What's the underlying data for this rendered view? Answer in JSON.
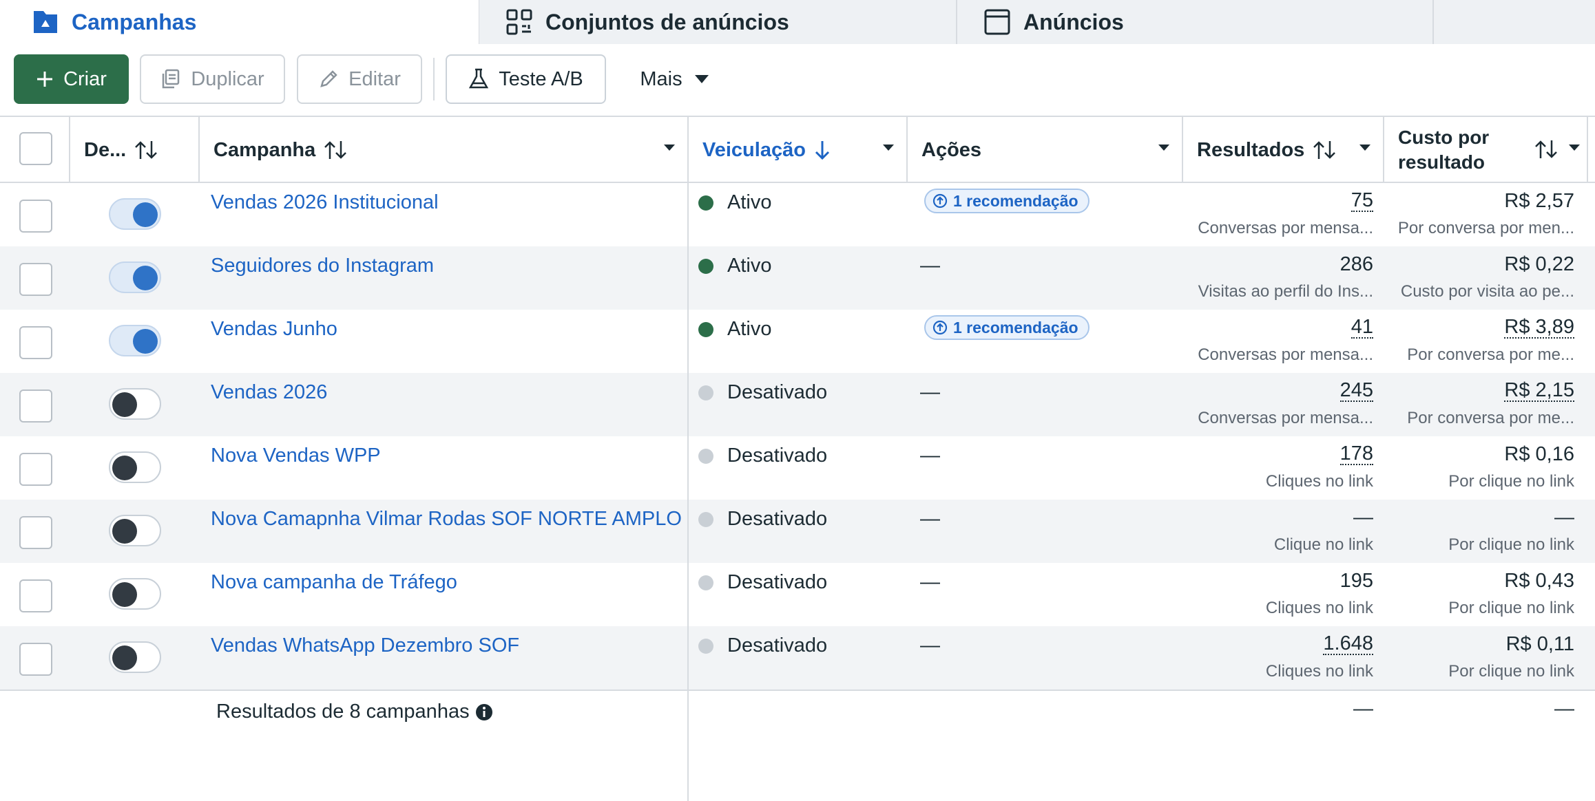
{
  "tabs": [
    {
      "label": "Campanhas",
      "icon": "folder-icon",
      "active": true
    },
    {
      "label": "Conjuntos de anúncios",
      "icon": "grid-icon",
      "active": false
    },
    {
      "label": "Anúncios",
      "icon": "ad-window-icon",
      "active": false
    }
  ],
  "toolbar": {
    "create_label": "Criar",
    "duplicate_label": "Duplicar",
    "edit_label": "Editar",
    "abtest_label": "Teste A/B",
    "more_label": "Mais"
  },
  "columns": {
    "delivery_toggle": "De...",
    "campaign": "Campanha",
    "delivery": "Veiculação",
    "actions": "Ações",
    "results": "Resultados",
    "cost_line1": "Custo por",
    "cost_line2": "resultado"
  },
  "rows": [
    {
      "name": "Vendas 2026 Institucional",
      "on": true,
      "status": "Ativo",
      "active": true,
      "action": "1 recomendação",
      "result": "75",
      "result_dotted": true,
      "result_label": "Conversas por mensa...",
      "cost": "R$ 2,57",
      "cost_dotted": false,
      "cost_label": "Por conversa por men..."
    },
    {
      "name": "Seguidores do Instagram",
      "on": true,
      "status": "Ativo",
      "active": true,
      "action": "—",
      "result": "286",
      "result_dotted": false,
      "result_label": "Visitas ao perfil do Ins...",
      "cost": "R$ 0,22",
      "cost_dotted": false,
      "cost_label": "Custo por visita ao pe..."
    },
    {
      "name": "Vendas Junho",
      "on": true,
      "status": "Ativo",
      "active": true,
      "action": "1 recomendação",
      "result": "41",
      "result_dotted": true,
      "result_label": "Conversas por mensa...",
      "cost": "R$ 3,89",
      "cost_dotted": true,
      "cost_label": "Por conversa por me..."
    },
    {
      "name": "Vendas 2026",
      "on": false,
      "status": "Desativado",
      "active": false,
      "action": "—",
      "result": "245",
      "result_dotted": true,
      "result_label": "Conversas por mensa...",
      "cost": "R$ 2,15",
      "cost_dotted": true,
      "cost_label": "Por conversa por me..."
    },
    {
      "name": "Nova Vendas WPP",
      "on": false,
      "status": "Desativado",
      "active": false,
      "action": "—",
      "result": "178",
      "result_dotted": true,
      "result_label": "Cliques no link",
      "cost": "R$ 0,16",
      "cost_dotted": false,
      "cost_label": "Por clique no link"
    },
    {
      "name": "Nova Camapnha Vilmar Rodas SOF NORTE AMPLO",
      "on": false,
      "status": "Desativado",
      "active": false,
      "action": "—",
      "result": "—",
      "result_dotted": false,
      "result_label": "Clique no link",
      "cost": "—",
      "cost_dotted": false,
      "cost_label": "Por clique no link"
    },
    {
      "name": "Nova campanha de Tráfego",
      "on": false,
      "status": "Desativado",
      "active": false,
      "action": "—",
      "result": "195",
      "result_dotted": false,
      "result_label": "Cliques no link",
      "cost": "R$ 0,43",
      "cost_dotted": false,
      "cost_label": "Por clique no link"
    },
    {
      "name": "Vendas WhatsApp Dezembro SOF",
      "on": false,
      "status": "Desativado",
      "active": false,
      "action": "—",
      "result": "1.648",
      "result_dotted": true,
      "result_label": "Cliques no link",
      "cost": "R$ 0,11",
      "cost_dotted": false,
      "cost_label": "Por clique no link"
    }
  ],
  "footer": {
    "summary": "Resultados de 8 campanhas",
    "result_total": "—",
    "cost_total": "—"
  },
  "colors": {
    "accent": "#1d64c4",
    "create_button": "#2c6e49",
    "active_dot": "#2c6e49",
    "inactive_dot": "#c9cfd5"
  }
}
